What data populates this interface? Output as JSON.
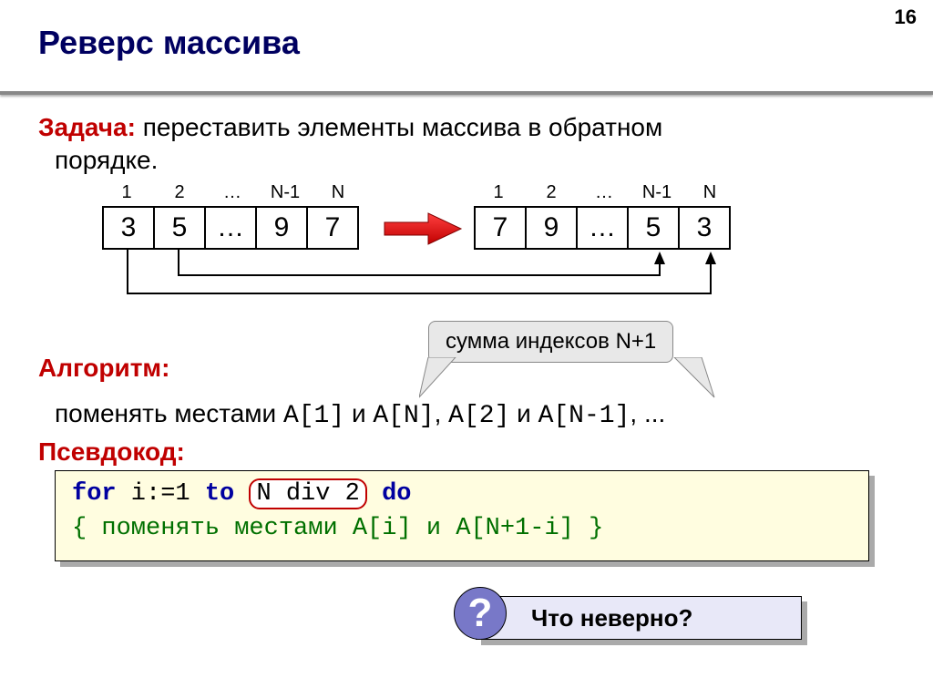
{
  "page_number": "16",
  "title": "Реверс массива",
  "task": {
    "label": "Задача:",
    "text_line1": " переставить элементы массива в обратном",
    "text_line2": "порядке."
  },
  "array_left": {
    "indices": [
      "1",
      "2",
      "…",
      "N-1",
      "N"
    ],
    "values": [
      "3",
      "5",
      "…",
      "9",
      "7"
    ]
  },
  "array_right": {
    "indices": [
      "1",
      "2",
      "…",
      "N-1",
      "N"
    ],
    "values": [
      "7",
      "9",
      "…",
      "5",
      "3"
    ]
  },
  "algorithm_label": "Алгоритм:",
  "balloon_text": "сумма индексов N+1",
  "swap": {
    "prefix": "поменять местами ",
    "pair1a": "A[1]",
    "and1": " и ",
    "pair1b": "A[N]",
    "sep": ", ",
    "pair2a": "A[2]",
    "and2": " и ",
    "pair2b": "A[N-1]",
    "tail": ", ..."
  },
  "pseudo_label": "Псевдокод:",
  "code": {
    "kw_for": "for",
    "ivar": " i:=1 ",
    "kw_to": "to",
    "highlight": "N div 2",
    "kw_do": "do",
    "line2": " { поменять местами A[i] и A[N+1-i] }"
  },
  "question": {
    "icon": "?",
    "text": "Что неверно?"
  }
}
